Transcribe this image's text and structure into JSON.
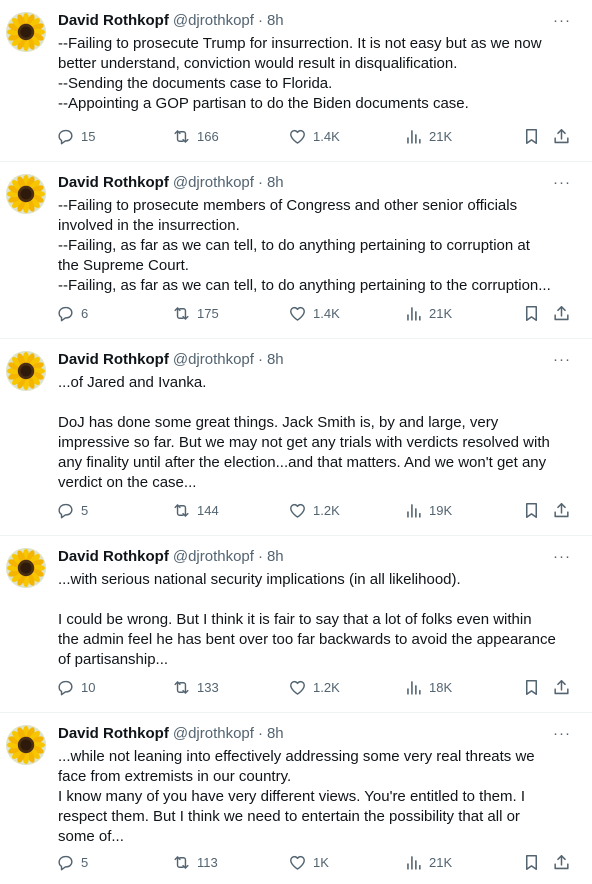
{
  "tweets": [
    {
      "author_name": "David Rothkopf",
      "author_handle": "@djrothkopf",
      "separator": "·",
      "time": "8h",
      "more": "···",
      "lines": [
        "--Failing to prosecute Trump for insurrection. It is not easy but as we now",
        "better understand, conviction would result in disqualification.",
        "--Sending the documents case to Florida.",
        "--Appointing a GOP partisan to do the Biden documents case."
      ],
      "replies": "15",
      "reposts": "166",
      "likes": "1.4K",
      "views": "21K"
    },
    {
      "author_name": "David Rothkopf",
      "author_handle": "@djrothkopf",
      "separator": "·",
      "time": "8h",
      "more": "···",
      "lines": [
        "--Failing to prosecute members of Congress and other senior officials",
        "involved in the insurrection.",
        "--Failing, as far as we can tell, to do anything pertaining to corruption at",
        "the Supreme Court.",
        "--Failing, as far as we can tell, to do anything pertaining to the corruption..."
      ],
      "replies": "6",
      "reposts": "175",
      "likes": "1.4K",
      "views": "21K"
    },
    {
      "author_name": "David Rothkopf",
      "author_handle": "@djrothkopf",
      "separator": "·",
      "time": "8h",
      "more": "···",
      "lines": [
        "...of Jared and Ivanka.",
        "",
        "DoJ has done some great things. Jack Smith is, by and large, very",
        "impressive so far. But we may not get any trials with verdicts resolved with",
        "any finality until after the election...and that matters. And we won't get any",
        "verdict on the case..."
      ],
      "replies": "5",
      "reposts": "144",
      "likes": "1.2K",
      "views": "19K"
    },
    {
      "author_name": "David Rothkopf",
      "author_handle": "@djrothkopf",
      "separator": "·",
      "time": "8h",
      "more": "···",
      "lines": [
        "...with serious national security implications (in all likelihood).",
        "",
        "I could be wrong. But I think it is fair to say that a lot of folks even within",
        "the admin feel he has bent over too far backwards to avoid the appearance",
        "of partisanship..."
      ],
      "replies": "10",
      "reposts": "133",
      "likes": "1.2K",
      "views": "18K"
    },
    {
      "author_name": "David Rothkopf",
      "author_handle": "@djrothkopf",
      "separator": "·",
      "time": "8h",
      "more": "···",
      "lines": [
        "...while not leaning into effectively addressing some very real threats we",
        "face from extremists in our country.",
        "I know many of you have very different views. You're entitled to them. I",
        "respect them. But I think we need to entertain the possibility that all or",
        "some of..."
      ],
      "replies": "5",
      "reposts": "113",
      "likes": "1K",
      "views": "21K"
    }
  ],
  "icons": {
    "avatar": "sunflower-avatar",
    "reply": "reply-icon",
    "repost": "repost-icon",
    "like": "like-icon",
    "views": "views-icon",
    "bookmark": "bookmark-icon",
    "share": "share-icon"
  },
  "colors": {
    "text": "#0f1419",
    "secondary": "#536471",
    "divider": "#eff3f4"
  }
}
